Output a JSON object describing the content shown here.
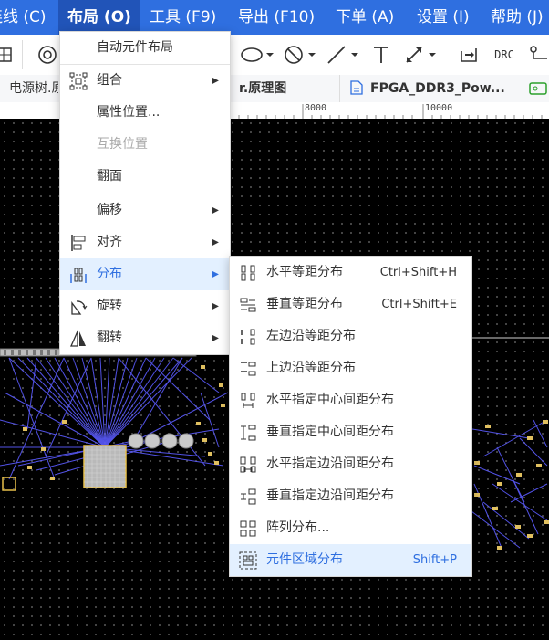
{
  "menubar": {
    "items": [
      {
        "label": "连线 (C)"
      },
      {
        "label": "布局 (O)"
      },
      {
        "label": "工具 (F9)"
      },
      {
        "label": "导出 (F10)"
      },
      {
        "label": "下单 (A)"
      },
      {
        "label": "设置 (I)"
      },
      {
        "label": "帮助 (J)"
      }
    ]
  },
  "toolbar": {
    "drc_label": "DRC",
    "icons": [
      "grid-icon",
      "target-icon",
      "ellipse-icon",
      "no-symbol-icon",
      "line-icon",
      "text-icon",
      "dimension-icon",
      "import-icon",
      "drc-icon",
      "route-icon"
    ]
  },
  "tabs": [
    {
      "label": "电源树.原理图"
    },
    {
      "label": "r.原理图"
    },
    {
      "label": "FPGA_DDR3_Pow..."
    }
  ],
  "ruler": {
    "ticks": [
      "8000",
      "10000"
    ]
  },
  "layout_menu": {
    "items": [
      {
        "label": "自动元件布局",
        "icon": "",
        "submenu": false,
        "disabled": false
      },
      {
        "label": "组合",
        "icon": "group-icon",
        "submenu": true,
        "disabled": false
      },
      {
        "label": "属性位置...",
        "icon": "",
        "submenu": false,
        "disabled": false
      },
      {
        "label": "互换位置",
        "icon": "",
        "submenu": false,
        "disabled": true
      },
      {
        "label": "翻面",
        "icon": "",
        "submenu": false,
        "disabled": false
      },
      {
        "label": "偏移",
        "icon": "",
        "submenu": true,
        "disabled": false
      },
      {
        "label": "对齐",
        "icon": "align-icon",
        "submenu": true,
        "disabled": false
      },
      {
        "label": "分布",
        "icon": "distribute-icon",
        "submenu": true,
        "disabled": false,
        "highlighted": true
      },
      {
        "label": "旋转",
        "icon": "rotate-icon",
        "submenu": true,
        "disabled": false
      },
      {
        "label": "翻转",
        "icon": "flip-icon",
        "submenu": true,
        "disabled": false
      }
    ]
  },
  "distribute_menu": {
    "items": [
      {
        "label": "水平等距分布",
        "shortcut": "Ctrl+Shift+H",
        "icon": "h-equal-distribute-icon"
      },
      {
        "label": "垂直等距分布",
        "shortcut": "Ctrl+Shift+E",
        "icon": "v-equal-distribute-icon"
      },
      {
        "label": "左边沿等距分布",
        "shortcut": "",
        "icon": "left-edge-distribute-icon"
      },
      {
        "label": "上边沿等距分布",
        "shortcut": "",
        "icon": "top-edge-distribute-icon"
      },
      {
        "label": "水平指定中心间距分布",
        "shortcut": "",
        "icon": "h-center-spacing-icon"
      },
      {
        "label": "垂直指定中心间距分布",
        "shortcut": "",
        "icon": "v-center-spacing-icon"
      },
      {
        "label": "水平指定边沿间距分布",
        "shortcut": "",
        "icon": "h-edge-spacing-icon"
      },
      {
        "label": "垂直指定边沿间距分布",
        "shortcut": "",
        "icon": "v-edge-spacing-icon"
      },
      {
        "label": "阵列分布...",
        "shortcut": "",
        "icon": "array-distribute-icon"
      },
      {
        "label": "元件区域分布",
        "shortcut": "Shift+P",
        "icon": "area-distribute-icon",
        "highlighted": true
      }
    ]
  },
  "colors": {
    "accent": "#2f6fe0",
    "highlight": "#e3f0ff",
    "net": "#5b5bff",
    "pad": "#e8c04a"
  }
}
